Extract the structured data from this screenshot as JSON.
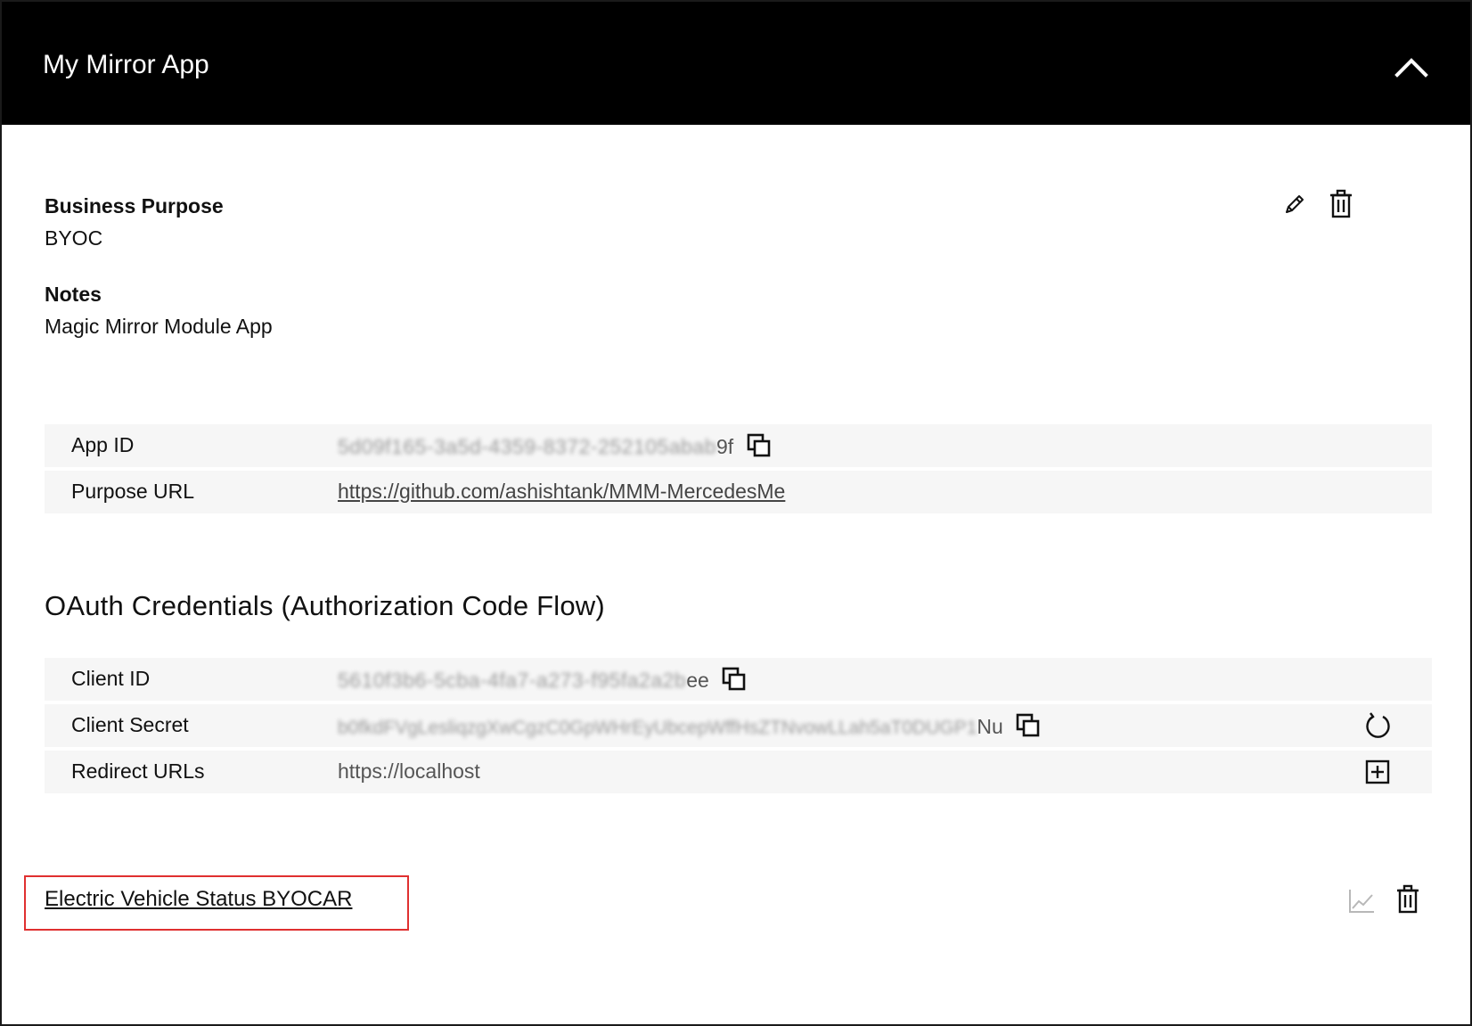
{
  "header": {
    "title": "My Mirror App"
  },
  "details": {
    "business_purpose_label": "Business Purpose",
    "business_purpose_value": "BYOC",
    "notes_label": "Notes",
    "notes_value": "Magic Mirror Module App"
  },
  "app_table": {
    "app_id_label": "App ID",
    "app_id_value_hidden": "5d09f165-3a5d-4359-8372-252105abab",
    "app_id_value_tail": "9f",
    "purpose_url_label": "Purpose URL",
    "purpose_url_value": "https://github.com/ashishtank/MMM-MercedesMe"
  },
  "oauth": {
    "section_title": "OAuth Credentials (Authorization Code Flow)",
    "client_id_label": "Client ID",
    "client_id_value_hidden": "5610f3b6-5cba-4fa7-a273-f95fa2a2b",
    "client_id_value_tail": "ee",
    "client_secret_label": "Client Secret",
    "client_secret_value_hidden": "b0fkdFVgLesliqzgXwCgzC0GpWHrEyUbcepWffHsZTNvowLLah5aT0DUGP1",
    "client_secret_value_tail": "Nu",
    "redirect_urls_label": "Redirect URLs",
    "redirect_urls_value": "https://localhost"
  },
  "product": {
    "name": "Electric Vehicle Status BYOCAR"
  },
  "colors": {
    "header_bg": "#000000",
    "row_bg": "#f6f6f6",
    "highlight_border": "#e03030"
  },
  "icons": {
    "collapse": "chevron-up-icon",
    "edit": "pencil-icon",
    "delete": "trash-icon",
    "copy": "copy-icon",
    "regenerate": "refresh-icon",
    "add": "plus-square-icon",
    "analytics": "line-chart-icon"
  }
}
